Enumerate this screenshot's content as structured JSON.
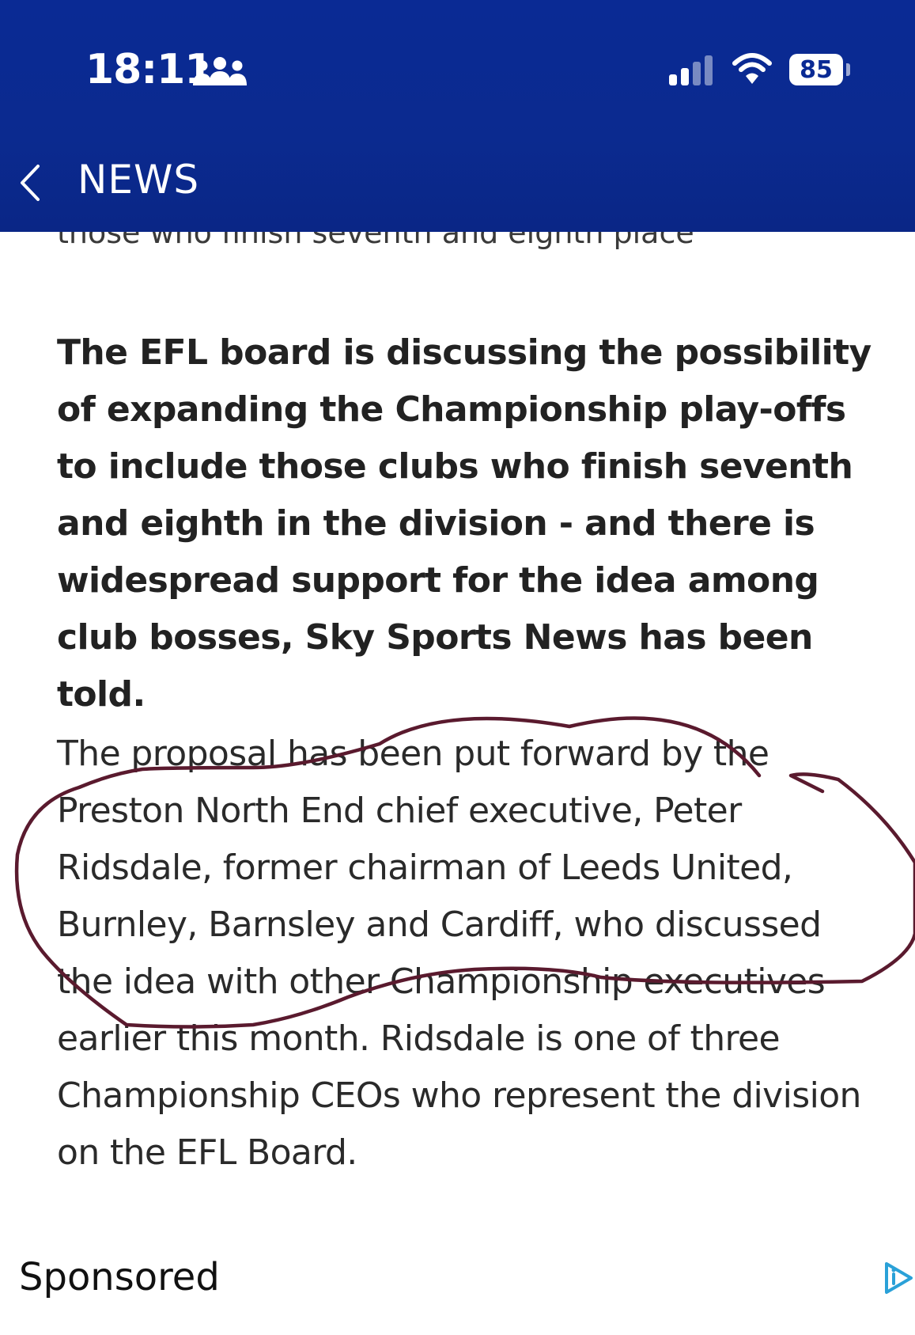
{
  "status_bar": {
    "time": "18:11",
    "battery": "85"
  },
  "nav": {
    "title": "NEWS"
  },
  "article": {
    "cut_off_line": "those who finish seventh and eighth place",
    "lead": "The EFL board is discussing the possibility of expanding the Championship play-offs to include those clubs who finish seventh and eighth in the division - and there is widespread support for the idea among club bosses, Sky Sports News has been told.",
    "body": "The proposal has been put forward by the Preston North End chief executive, Peter Ridsdale, former chairman of Leeds United, Burnley, Barnsley and Cardiff, who discussed the idea with other Championship executives earlier this month. Ridsdale is one of three Championship CEOs who represent the division on the EFL Board."
  },
  "sponsored": {
    "label": "Sponsored"
  },
  "icons": {
    "people": "people-group-icon",
    "signal": "cellular-signal-icon",
    "wifi": "wifi-icon",
    "back": "chevron-left-icon",
    "ad": "adchoices-icon"
  },
  "colors": {
    "header": "#0b2a8f",
    "annotation_stroke": "#5a1a2e"
  }
}
